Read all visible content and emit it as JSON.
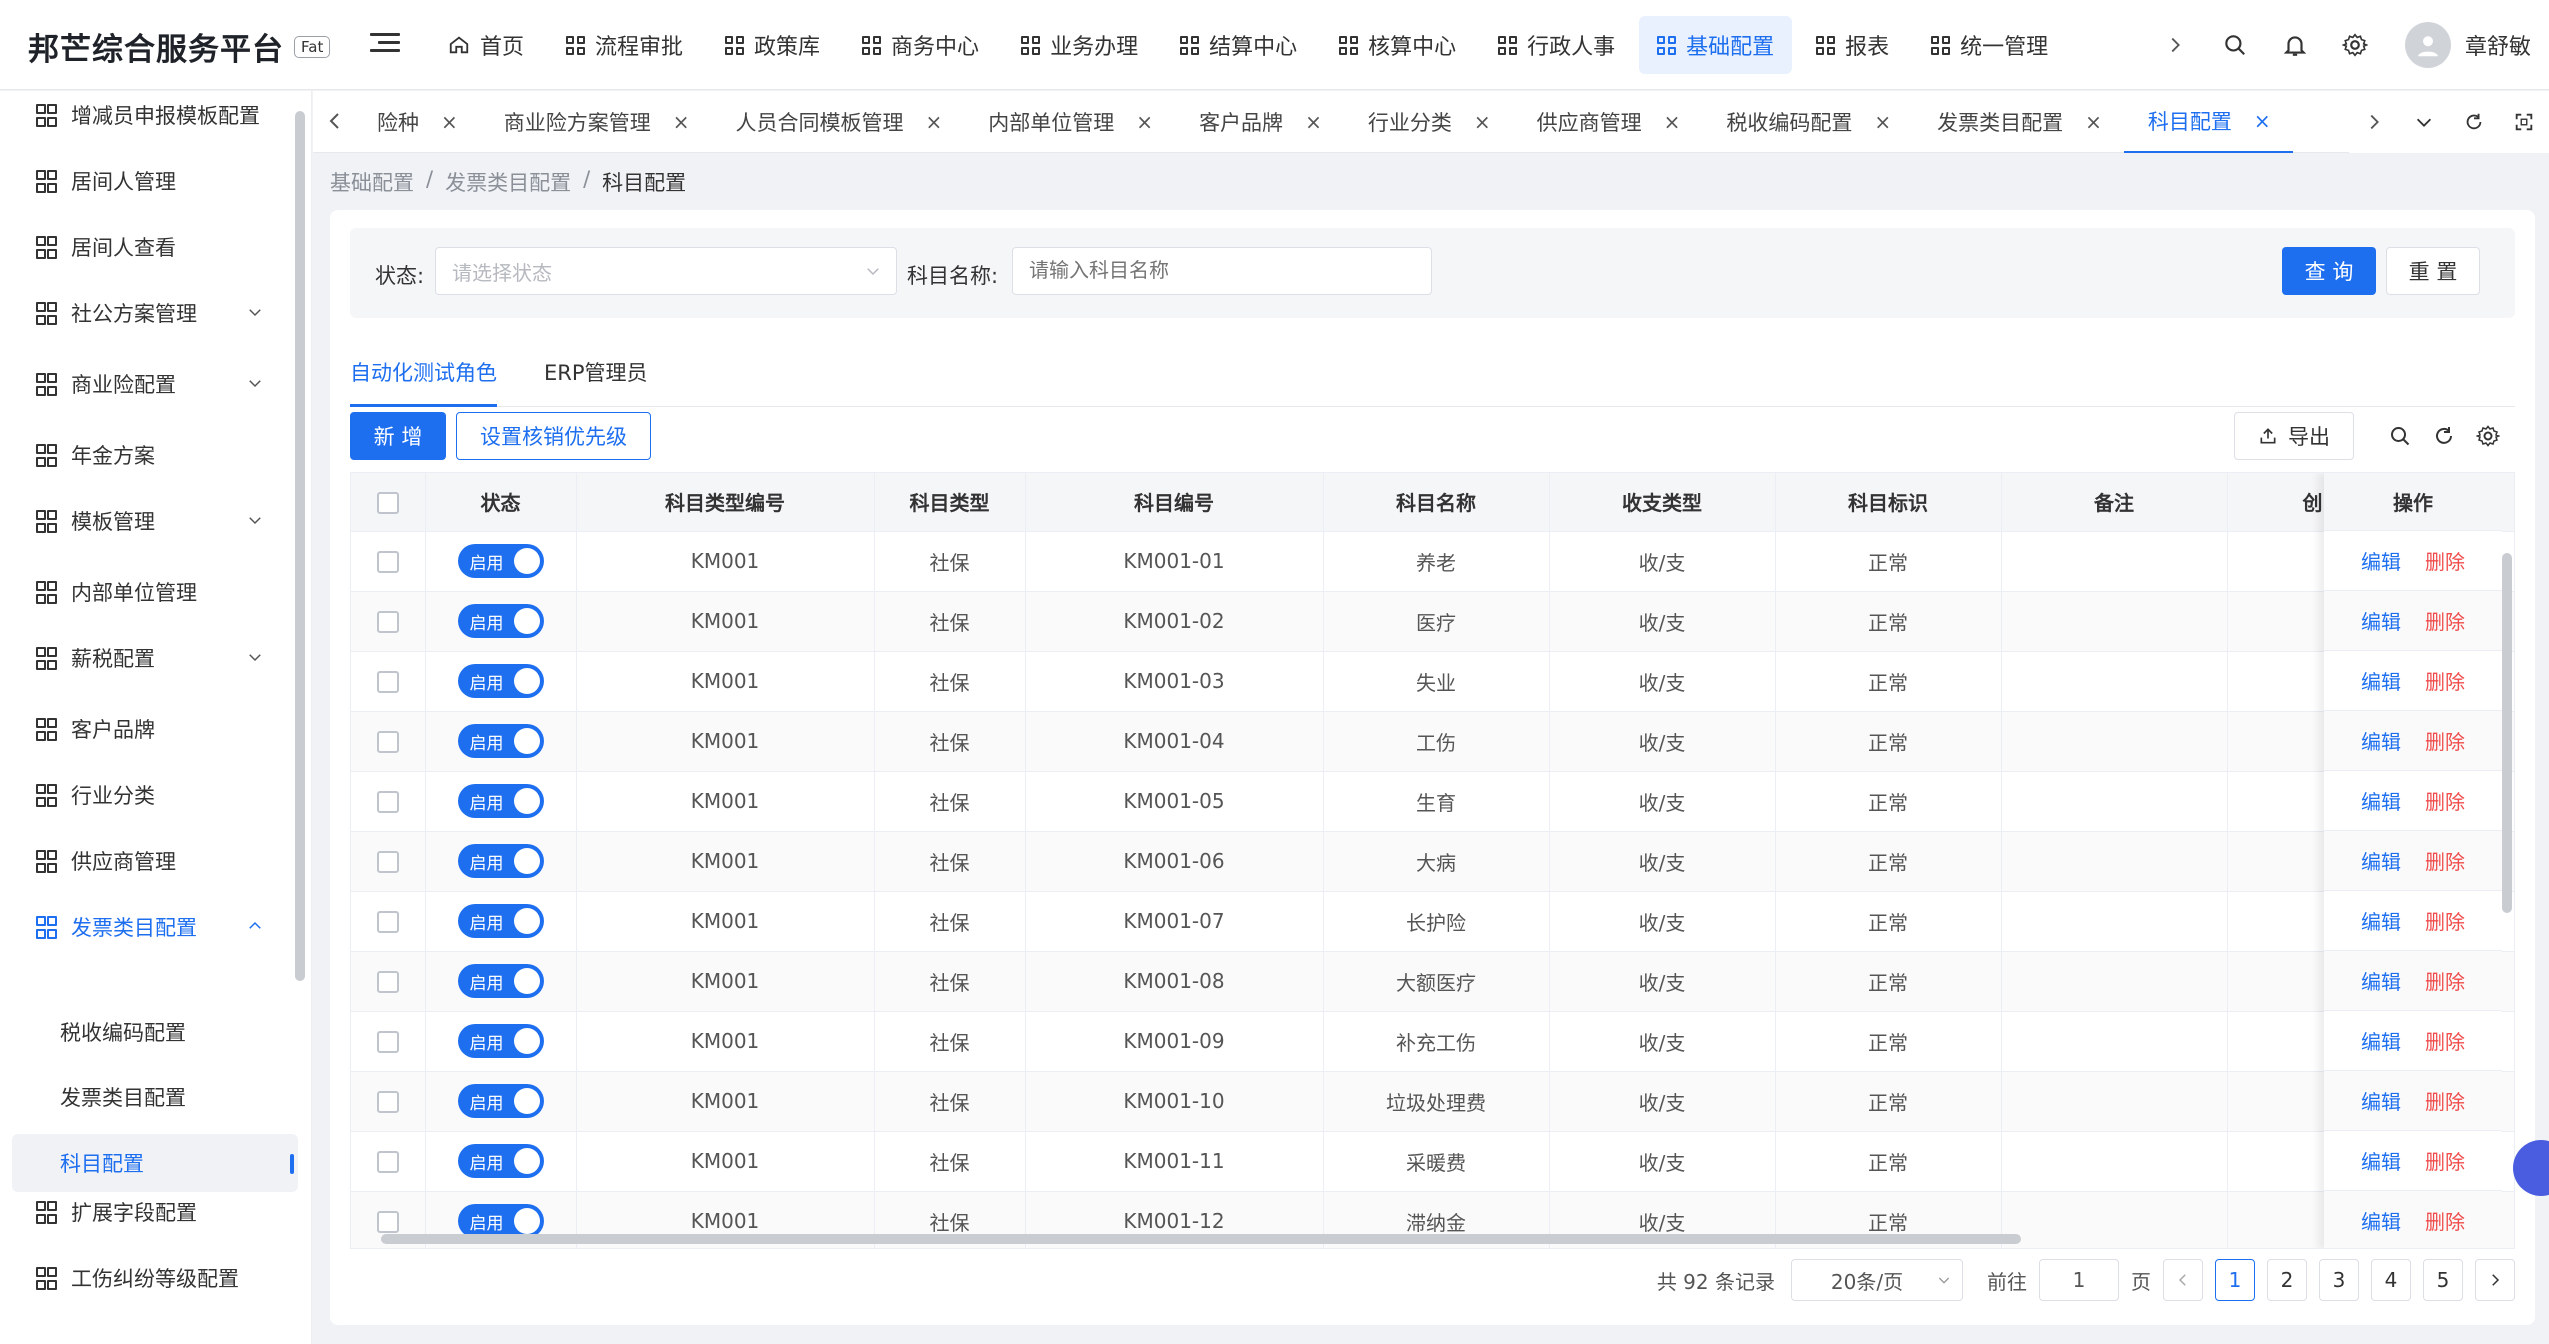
{
  "app": {
    "title": "邦芒综合服务平台",
    "env": "Fat"
  },
  "topnav": [
    {
      "label": "首页",
      "icon": "home-icon"
    },
    {
      "label": "流程审批",
      "icon": "grid-icon"
    },
    {
      "label": "政策库",
      "icon": "grid-icon"
    },
    {
      "label": "商务中心",
      "icon": "grid-icon"
    },
    {
      "label": "业务办理",
      "icon": "grid-icon"
    },
    {
      "label": "结算中心",
      "icon": "grid-icon"
    },
    {
      "label": "核算中心",
      "icon": "grid-icon"
    },
    {
      "label": "行政人事",
      "icon": "grid-icon"
    },
    {
      "label": "基础配置",
      "icon": "grid-icon",
      "active": true
    },
    {
      "label": "报表",
      "icon": "grid-icon"
    },
    {
      "label": "统一管理",
      "icon": "grid-icon"
    }
  ],
  "user": {
    "name": "章舒敏"
  },
  "sidebar": {
    "items": [
      {
        "label": "增减员申报模板配置"
      },
      {
        "label": "居间人管理"
      },
      {
        "label": "居间人查看"
      },
      {
        "label": "社公方案管理",
        "expandable": true
      },
      {
        "label": "商业险配置",
        "expandable": true
      },
      {
        "label": "年金方案"
      },
      {
        "label": "模板管理",
        "expandable": true
      },
      {
        "label": "内部单位管理"
      },
      {
        "label": "薪税配置",
        "expandable": true
      },
      {
        "label": "客户品牌"
      },
      {
        "label": "行业分类"
      },
      {
        "label": "供应商管理"
      },
      {
        "label": "发票类目配置",
        "expandable": true,
        "open": true
      },
      {
        "label": "扩展字段配置"
      },
      {
        "label": "工伤纠纷等级配置"
      }
    ],
    "subitems": [
      {
        "label": "税收编码配置"
      },
      {
        "label": "发票类目配置"
      },
      {
        "label": "科目配置",
        "active": true
      }
    ]
  },
  "tabs": [
    {
      "label": "险种"
    },
    {
      "label": "商业险方案管理"
    },
    {
      "label": "人员合同模板管理"
    },
    {
      "label": "内部单位管理"
    },
    {
      "label": "客户品牌"
    },
    {
      "label": "行业分类"
    },
    {
      "label": "供应商管理"
    },
    {
      "label": "税收编码配置"
    },
    {
      "label": "发票类目配置"
    },
    {
      "label": "科目配置",
      "active": true
    }
  ],
  "breadcrumb": [
    "基础配置",
    "发票类目配置",
    "科目配置"
  ],
  "filter": {
    "status_label": "状态:",
    "status_placeholder": "请选择状态",
    "name_label": "科目名称:",
    "name_placeholder": "请输入科目名称",
    "query": "查 询",
    "reset": "重 置"
  },
  "role_tabs": [
    {
      "label": "自动化测试角色",
      "active": true
    },
    {
      "label": "ERP管理员"
    }
  ],
  "toolbar": {
    "add": "新 增",
    "priority": "设置核销优先级",
    "export": "导出"
  },
  "table": {
    "columns": [
      "状态",
      "科目类型编号",
      "科目类型",
      "科目编号",
      "科目名称",
      "收支类型",
      "科目标识",
      "备注",
      "创",
      "操作"
    ],
    "status_on": "启用",
    "edit": "编辑",
    "delete": "删除",
    "rows": [
      {
        "type_code": "KM001",
        "type": "社保",
        "code": "KM001-01",
        "name": "养老",
        "io": "收/支",
        "flag": "正常",
        "remark": ""
      },
      {
        "type_code": "KM001",
        "type": "社保",
        "code": "KM001-02",
        "name": "医疗",
        "io": "收/支",
        "flag": "正常",
        "remark": ""
      },
      {
        "type_code": "KM001",
        "type": "社保",
        "code": "KM001-03",
        "name": "失业",
        "io": "收/支",
        "flag": "正常",
        "remark": ""
      },
      {
        "type_code": "KM001",
        "type": "社保",
        "code": "KM001-04",
        "name": "工伤",
        "io": "收/支",
        "flag": "正常",
        "remark": ""
      },
      {
        "type_code": "KM001",
        "type": "社保",
        "code": "KM001-05",
        "name": "生育",
        "io": "收/支",
        "flag": "正常",
        "remark": ""
      },
      {
        "type_code": "KM001",
        "type": "社保",
        "code": "KM001-06",
        "name": "大病",
        "io": "收/支",
        "flag": "正常",
        "remark": ""
      },
      {
        "type_code": "KM001",
        "type": "社保",
        "code": "KM001-07",
        "name": "长护险",
        "io": "收/支",
        "flag": "正常",
        "remark": ""
      },
      {
        "type_code": "KM001",
        "type": "社保",
        "code": "KM001-08",
        "name": "大额医疗",
        "io": "收/支",
        "flag": "正常",
        "remark": ""
      },
      {
        "type_code": "KM001",
        "type": "社保",
        "code": "KM001-09",
        "name": "补充工伤",
        "io": "收/支",
        "flag": "正常",
        "remark": ""
      },
      {
        "type_code": "KM001",
        "type": "社保",
        "code": "KM001-10",
        "name": "垃圾处理费",
        "io": "收/支",
        "flag": "正常",
        "remark": ""
      },
      {
        "type_code": "KM001",
        "type": "社保",
        "code": "KM001-11",
        "name": "采暖费",
        "io": "收/支",
        "flag": "正常",
        "remark": ""
      },
      {
        "type_code": "KM001",
        "type": "社保",
        "code": "KM001-12",
        "name": "滞纳金",
        "io": "收/支",
        "flag": "正常",
        "remark": ""
      }
    ]
  },
  "pagination": {
    "total": "共 92 条记录",
    "page_size": "20条/页",
    "goto_prefix": "前往",
    "goto_value": "1",
    "goto_suffix": "页",
    "pages": [
      "1",
      "2",
      "3",
      "4",
      "5"
    ],
    "current": "1"
  },
  "colors": {
    "primary": "#1e6ff0",
    "danger": "#f04c4c"
  }
}
